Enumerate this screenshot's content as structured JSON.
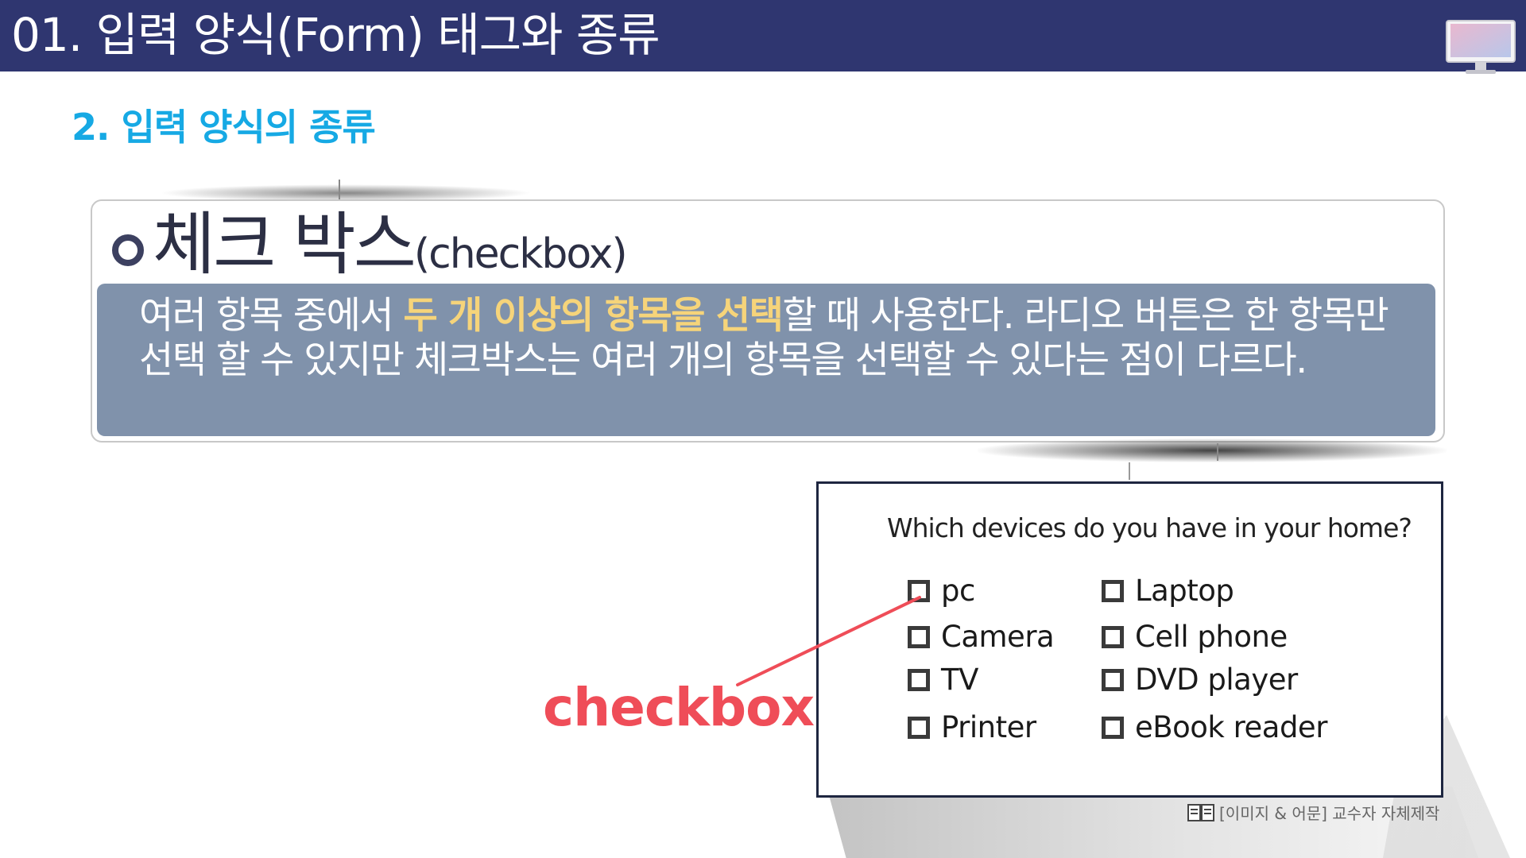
{
  "header": {
    "title": "01. 입력 양식(Form) 태그와 종류",
    "icon": "monitor-icon"
  },
  "section": {
    "title": "2. 입력 양식의 종류"
  },
  "card": {
    "heading_ko": "체크 박스",
    "heading_en": "(checkbox)",
    "desc_before": "여러 항목 중에서 ",
    "desc_highlight": "두 개 이상의 항목을 선택",
    "desc_after": "할 때 사용한다. 라디오 버튼은 한 항목만 선택 할 수 있지만 체크박스는 여러 개의 항목을 선택할 수 있다는 점이 다르다."
  },
  "example": {
    "question": "Which devices do you have in your home?",
    "left_options": [
      "pc",
      "Camera",
      "TV",
      "Printer"
    ],
    "right_options": [
      "Laptop",
      "Cell phone",
      "DVD player",
      "eBook reader"
    ]
  },
  "annotation": {
    "label": "checkbox"
  },
  "credit": {
    "text": "[이미지 & 어문] 교수자 자체제작"
  },
  "colors": {
    "header_bg": "#2f3670",
    "section_title": "#16a9e4",
    "desc_bg": "#8092ab",
    "highlight": "#f6d47a",
    "annotation": "#ef4d58"
  }
}
